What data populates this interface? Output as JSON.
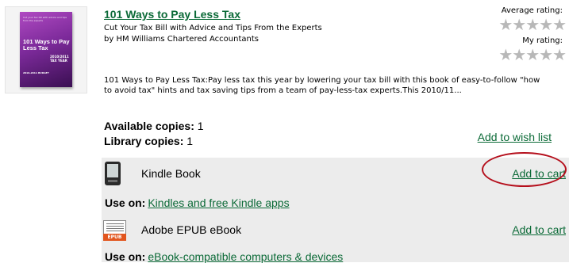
{
  "book": {
    "cover_image": {
      "small_text": "Cut your tax bill with advice and tips from the experts",
      "title": "101 Ways to Pay Less Tax",
      "year": "2010/2011 TAX YEAR",
      "budget": "2010-2011 BUDGET"
    },
    "title": "101 Ways to Pay Less Tax",
    "subtitle": "Cut Your Tax Bill with Advice and Tips From the Experts",
    "author": "by HM Williams Chartered Accountants",
    "description": "101 Ways to Pay Less Tax:Pay less tax this year by lowering your tax bill with this book of easy-to-follow \"how to avoid tax\" hints and tax saving tips from a team of pay-less-tax experts.This 2010/11..."
  },
  "ratings": {
    "average_label": "Average rating:",
    "average_value": 0,
    "my_label": "My rating:",
    "my_value": 0,
    "max": 5,
    "star_glyph": "★★★★★",
    "star_color": "#b8b8b8"
  },
  "availability": {
    "available_label": "Available copies:",
    "available_count": "1",
    "library_label": "Library copies:",
    "library_count": "1",
    "wish_list": "Add to wish list"
  },
  "formats": [
    {
      "name": "Kindle Book",
      "icon": "kindle-device-icon",
      "add_to_cart": "Add to cart",
      "use_on_label": "Use on:",
      "use_on_link": "Kindles and free Kindle apps"
    },
    {
      "name": "Adobe EPUB eBook",
      "icon": "epub-icon",
      "icon_badge": "EPUB",
      "add_to_cart": "Add to cart",
      "use_on_label": "Use on:",
      "use_on_link": "eBook-compatible computers & devices"
    }
  ],
  "colors": {
    "link": "#0b6a37",
    "panel_bg": "#ececec",
    "highlight": "#b50f1c",
    "epub_badge": "#e2561f"
  }
}
